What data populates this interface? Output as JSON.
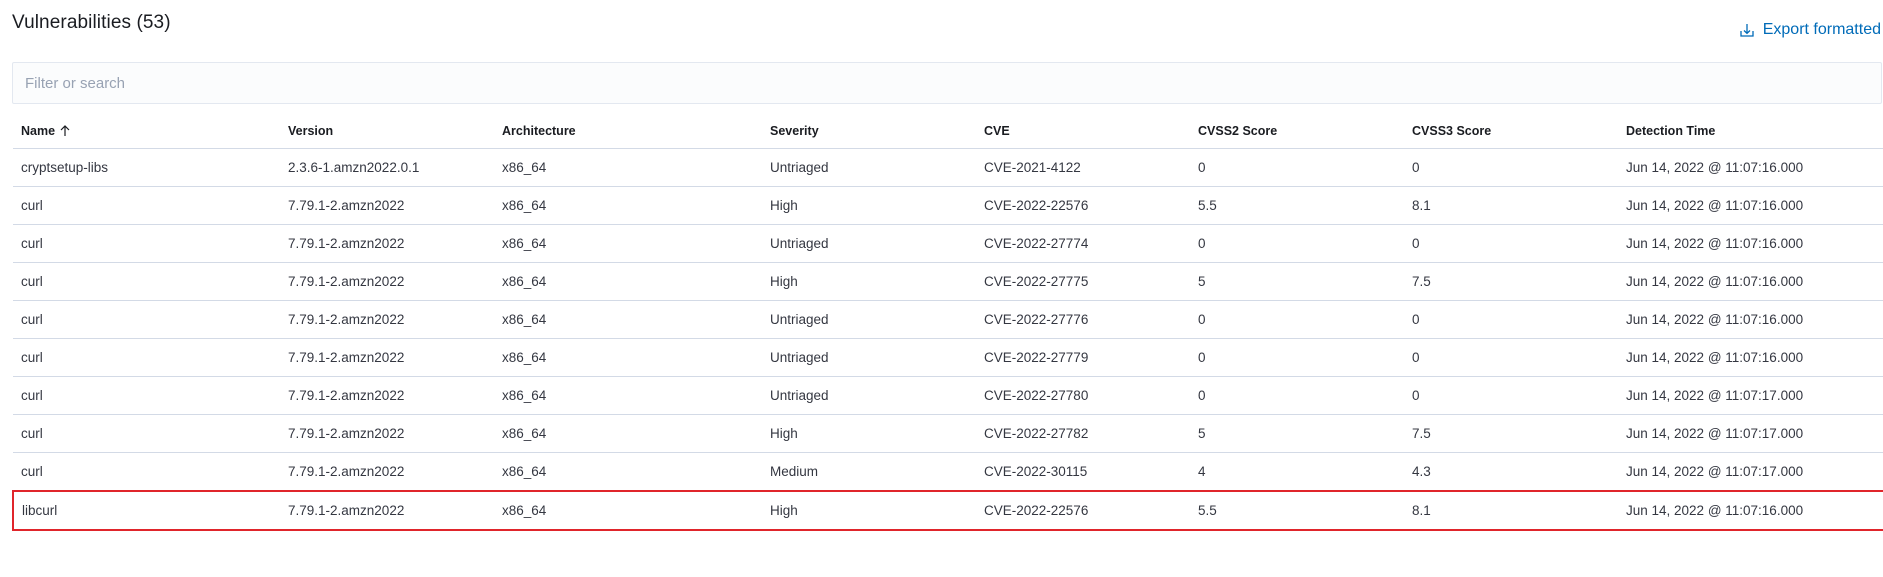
{
  "header": {
    "title": "Vulnerabilities (53)",
    "export_label": "Export formatted"
  },
  "search": {
    "placeholder": "Filter or search",
    "value": ""
  },
  "table": {
    "columns": [
      {
        "label": "Name",
        "sort": "ascending"
      },
      {
        "label": "Version"
      },
      {
        "label": "Architecture"
      },
      {
        "label": "Severity"
      },
      {
        "label": "CVE"
      },
      {
        "label": "CVSS2 Score"
      },
      {
        "label": "CVSS3 Score"
      },
      {
        "label": "Detection Time"
      }
    ],
    "rows": [
      [
        "cryptsetup-libs",
        "2.3.6-1.amzn2022.0.1",
        "x86_64",
        "Untriaged",
        "CVE-2021-4122",
        "0",
        "0",
        "Jun 14, 2022 @ 11:07:16.000"
      ],
      [
        "curl",
        "7.79.1-2.amzn2022",
        "x86_64",
        "High",
        "CVE-2022-22576",
        "5.5",
        "8.1",
        "Jun 14, 2022 @ 11:07:16.000"
      ],
      [
        "curl",
        "7.79.1-2.amzn2022",
        "x86_64",
        "Untriaged",
        "CVE-2022-27774",
        "0",
        "0",
        "Jun 14, 2022 @ 11:07:16.000"
      ],
      [
        "curl",
        "7.79.1-2.amzn2022",
        "x86_64",
        "High",
        "CVE-2022-27775",
        "5",
        "7.5",
        "Jun 14, 2022 @ 11:07:16.000"
      ],
      [
        "curl",
        "7.79.1-2.amzn2022",
        "x86_64",
        "Untriaged",
        "CVE-2022-27776",
        "0",
        "0",
        "Jun 14, 2022 @ 11:07:16.000"
      ],
      [
        "curl",
        "7.79.1-2.amzn2022",
        "x86_64",
        "Untriaged",
        "CVE-2022-27779",
        "0",
        "0",
        "Jun 14, 2022 @ 11:07:16.000"
      ],
      [
        "curl",
        "7.79.1-2.amzn2022",
        "x86_64",
        "Untriaged",
        "CVE-2022-27780",
        "0",
        "0",
        "Jun 14, 2022 @ 11:07:17.000"
      ],
      [
        "curl",
        "7.79.1-2.amzn2022",
        "x86_64",
        "High",
        "CVE-2022-27782",
        "5",
        "7.5",
        "Jun 14, 2022 @ 11:07:17.000"
      ],
      [
        "curl",
        "7.79.1-2.amzn2022",
        "x86_64",
        "Medium",
        "CVE-2022-30115",
        "4",
        "4.3",
        "Jun 14, 2022 @ 11:07:17.000"
      ],
      [
        "libcurl",
        "7.79.1-2.amzn2022",
        "x86_64",
        "High",
        "CVE-2022-22576",
        "5.5",
        "8.1",
        "Jun 14, 2022 @ 11:07:16.000"
      ]
    ],
    "highlighted_row_index": 9
  },
  "colors": {
    "accent": "#006bb8",
    "highlight_border": "#e0252b",
    "row_border": "#d3dae6"
  },
  "icons": {
    "export": "download-icon",
    "sort": "arrow-up-icon"
  }
}
